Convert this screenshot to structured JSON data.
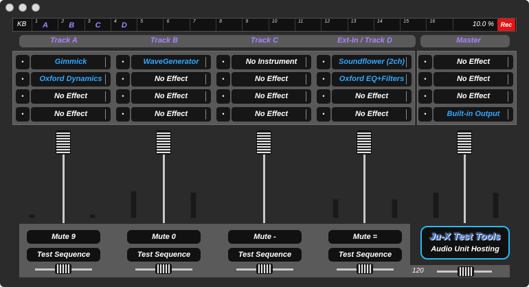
{
  "keyboard": {
    "label": "KB",
    "keys": [
      {
        "num": "1",
        "letter": "A"
      },
      {
        "num": "2",
        "letter": "B"
      },
      {
        "num": "3",
        "letter": "C"
      },
      {
        "num": "4",
        "letter": "D"
      },
      {
        "num": "5",
        "letter": ""
      },
      {
        "num": "6",
        "letter": ""
      },
      {
        "num": "7",
        "letter": ""
      },
      {
        "num": "8",
        "letter": ""
      },
      {
        "num": "9",
        "letter": ""
      },
      {
        "num": "10",
        "letter": ""
      },
      {
        "num": "11",
        "letter": ""
      },
      {
        "num": "12",
        "letter": ""
      },
      {
        "num": "13",
        "letter": ""
      },
      {
        "num": "14",
        "letter": ""
      },
      {
        "num": "15",
        "letter": ""
      },
      {
        "num": "16",
        "letter": ""
      }
    ],
    "cpu": "10.0 %",
    "rec_label": "Rec"
  },
  "tracks": [
    {
      "header": "Track A",
      "slots": [
        {
          "dot": "•",
          "name": "Gimmick",
          "active": true
        },
        {
          "dot": "•",
          "name": "Oxford Dynamics",
          "active": true
        },
        {
          "dot": "•",
          "name": "No Effect",
          "active": false
        },
        {
          "dot": "•",
          "name": "No Effect",
          "active": false
        }
      ],
      "mute": "Mute  9",
      "seq": "Test Sequence"
    },
    {
      "header": "Track B",
      "slots": [
        {
          "dot": "•",
          "name": "WaveGenerator",
          "active": true
        },
        {
          "dot": "•",
          "name": "No Effect",
          "active": false
        },
        {
          "dot": "•",
          "name": "No Effect",
          "active": false
        },
        {
          "dot": "•",
          "name": "No Effect",
          "active": false
        }
      ],
      "mute": "Mute  0",
      "seq": "Test Sequence"
    },
    {
      "header": "Track C",
      "slots": [
        {
          "dot": "•",
          "name": "No Instrument",
          "active": false
        },
        {
          "dot": "•",
          "name": "No Effect",
          "active": false
        },
        {
          "dot": "•",
          "name": "No Effect",
          "active": false
        },
        {
          "dot": "•",
          "name": "No Effect",
          "active": false
        }
      ],
      "mute": "Mute  -",
      "seq": "Test Sequence"
    },
    {
      "header": "Ext-In / Track D",
      "slots": [
        {
          "dot": "•",
          "name": "Soundflower (2ch)",
          "active": true
        },
        {
          "dot": "•",
          "name": "Oxford EQ+Filters",
          "active": true
        },
        {
          "dot": "•",
          "name": "No Effect",
          "active": false
        },
        {
          "dot": "•",
          "name": "No Effect",
          "active": false
        }
      ],
      "mute": "Mute  =",
      "seq": "Test Sequence"
    }
  ],
  "master": {
    "header": "Master",
    "slots": [
      {
        "dot": "•",
        "name": "No Effect",
        "active": false
      },
      {
        "dot": "•",
        "name": "No Effect",
        "active": false
      },
      {
        "dot": "•",
        "name": "No Effect",
        "active": false
      },
      {
        "dot": "•",
        "name": "Built-in Output",
        "active": true
      }
    ]
  },
  "logo": {
    "title": "Ju-X Test Tools",
    "subtitle": "Audio Unit Hosting"
  },
  "tempo": "120",
  "colors": {
    "accent_purple": "#a784ff",
    "active_blue": "#2fa8ff",
    "rec_red": "#e01515",
    "logo_border": "#2bb8f2"
  }
}
